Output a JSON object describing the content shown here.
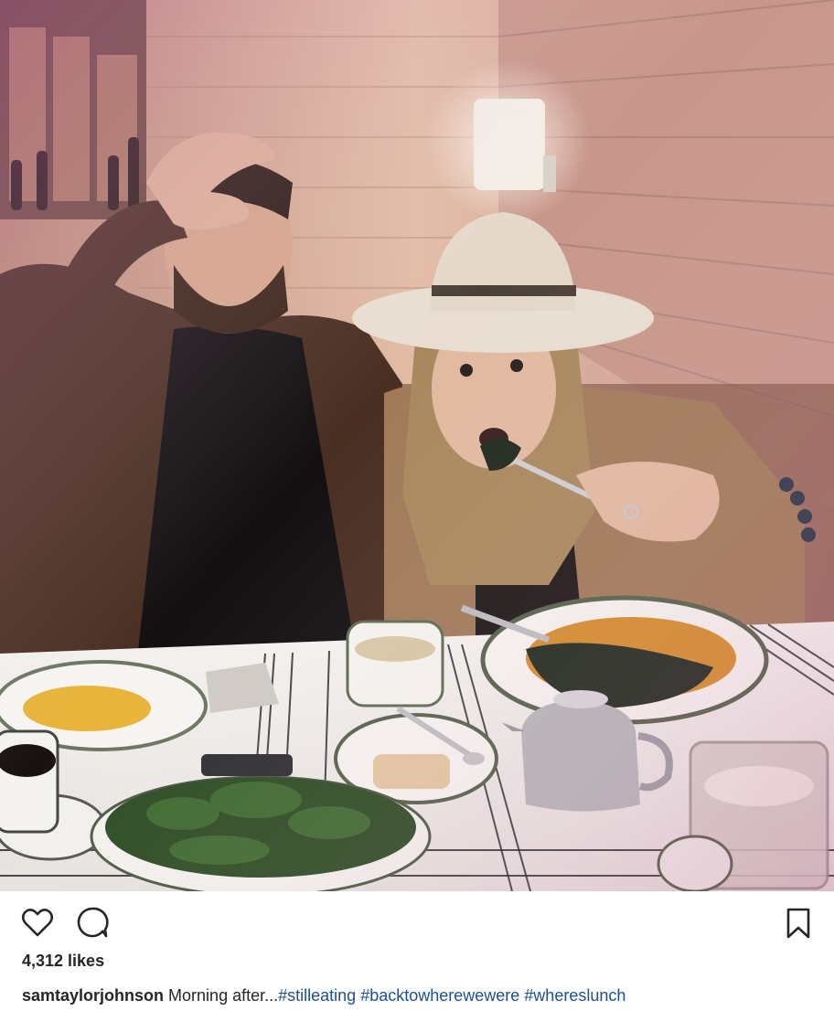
{
  "post": {
    "username": "samtaylorjohnson",
    "caption_text": "Morning after...",
    "hashtags": [
      "#stilleating",
      "#backtowherewewere",
      "#whereslunch"
    ],
    "likes": "4,312 likes"
  },
  "icons": {
    "like": "heart-outline-icon",
    "comment": "speech-bubble-icon",
    "save": "bookmark-outline-icon"
  },
  "colors": {
    "text": "#262626",
    "hashtag": "#1d4f91",
    "background": "#ffffff"
  }
}
